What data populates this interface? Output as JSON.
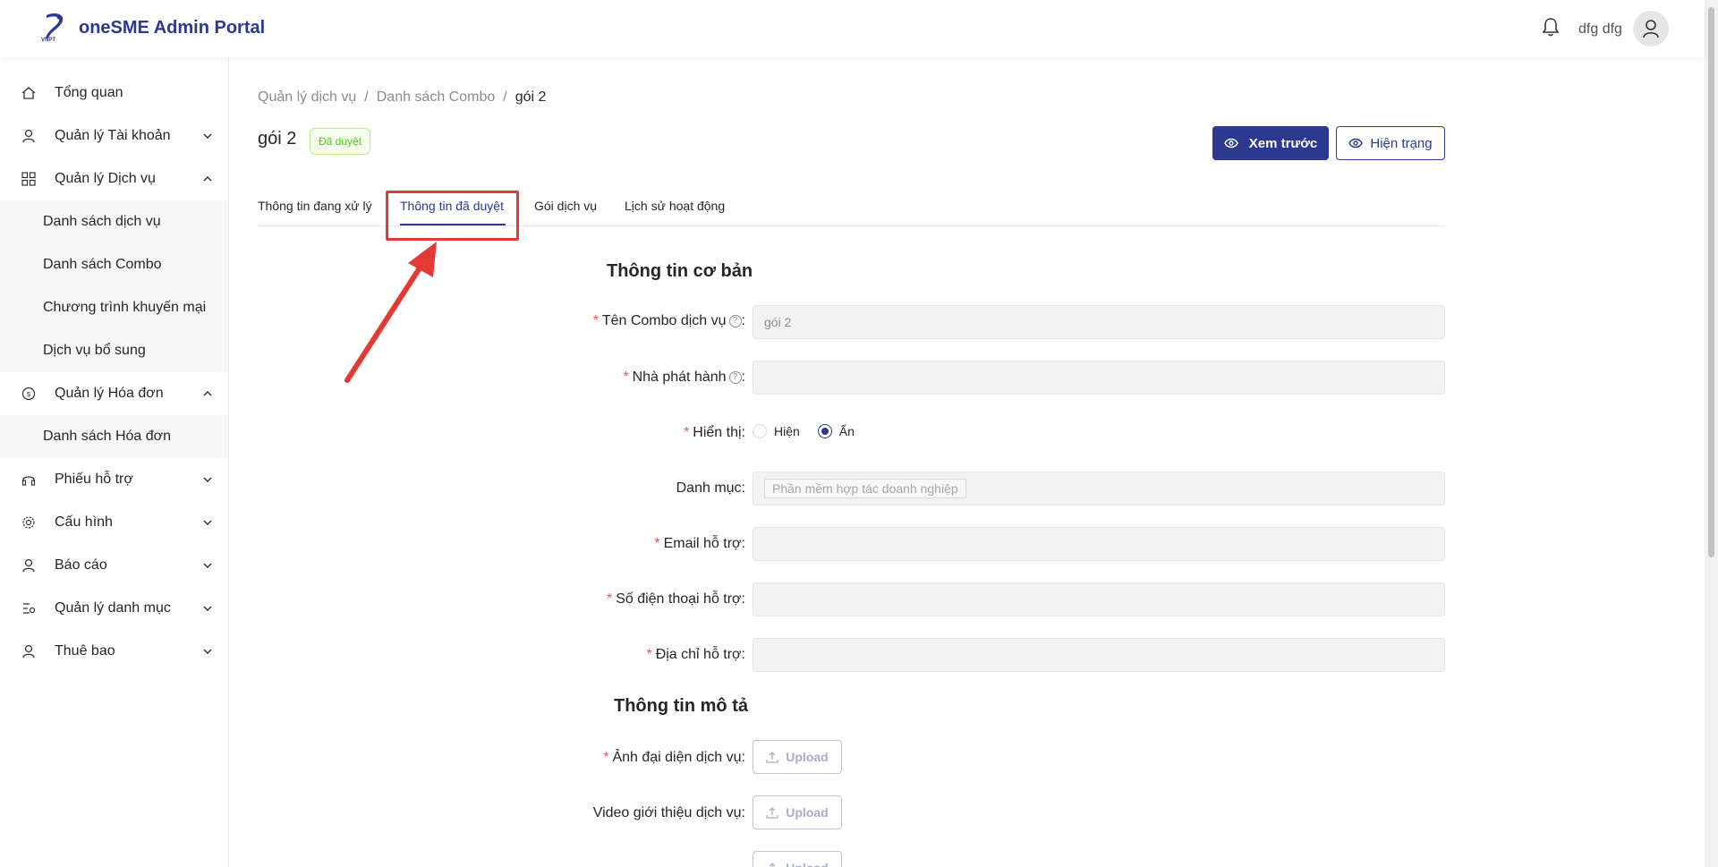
{
  "header": {
    "logo_text": "VNPT",
    "title": "oneSME Admin Portal",
    "user_name": "dfg dfg"
  },
  "sidebar": {
    "items": [
      {
        "label": "Tổng quan",
        "icon": "home-icon"
      },
      {
        "label": "Quản lý Tài khoản",
        "icon": "user-icon"
      },
      {
        "label": "Quản lý Dịch vụ",
        "icon": "grid-icon"
      },
      {
        "label": "Quản lý Hóa đơn",
        "icon": "dollar-circle-icon"
      },
      {
        "label": "Phiếu hỗ trợ",
        "icon": "headset-icon"
      },
      {
        "label": "Cấu hình",
        "icon": "gear-icon"
      },
      {
        "label": "Báo cáo",
        "icon": "user-icon"
      },
      {
        "label": "Quản lý danh mục",
        "icon": "settings-list-icon"
      },
      {
        "label": "Thuê bao",
        "icon": "user-icon"
      }
    ],
    "service_sub": [
      "Danh sách dịch vụ",
      "Danh sách Combo",
      "Chương trình khuyến mại",
      "Dịch vụ bổ sung"
    ],
    "invoice_sub": [
      "Danh sách Hóa đơn"
    ]
  },
  "breadcrumb": [
    "Quản lý dịch vụ",
    "Danh sách Combo",
    "gói 2"
  ],
  "page": {
    "title": "gói 2",
    "status": "Đã duyệt",
    "preview_button": "Xem trước",
    "status_button": "Hiện trạng"
  },
  "tabs": [
    "Thông tin đang xử lý",
    "Thông tin đã duyệt",
    "Gói dịch vụ",
    "Lịch sử hoạt động"
  ],
  "basic_info": {
    "title": "Thông tin cơ bản",
    "name_label": "Tên Combo dịch vụ",
    "name_value": "gói 2",
    "publisher_label": "Nhà phát hành",
    "publisher_value": "",
    "display_label": "Hiển thị",
    "display_show": "Hiện",
    "display_hide": "Ẩn",
    "category_label": "Danh mục",
    "category_value": "Phần mềm hợp tác doanh nghiệp",
    "email_label": "Email hỗ trợ",
    "phone_label": "Số điện thoại hỗ trợ",
    "address_label": "Địa chỉ hỗ trợ"
  },
  "description": {
    "title": "Thông tin mô tả",
    "avatar_label": "Ảnh đại diện dịch vụ",
    "video_label": "Video giới thiệu dịch vụ",
    "upload_label": "Upload"
  },
  "colors": {
    "brand": "#2b3990",
    "success": "#52c41a",
    "required": "#ff4d4f",
    "highlight": "#e53935"
  }
}
